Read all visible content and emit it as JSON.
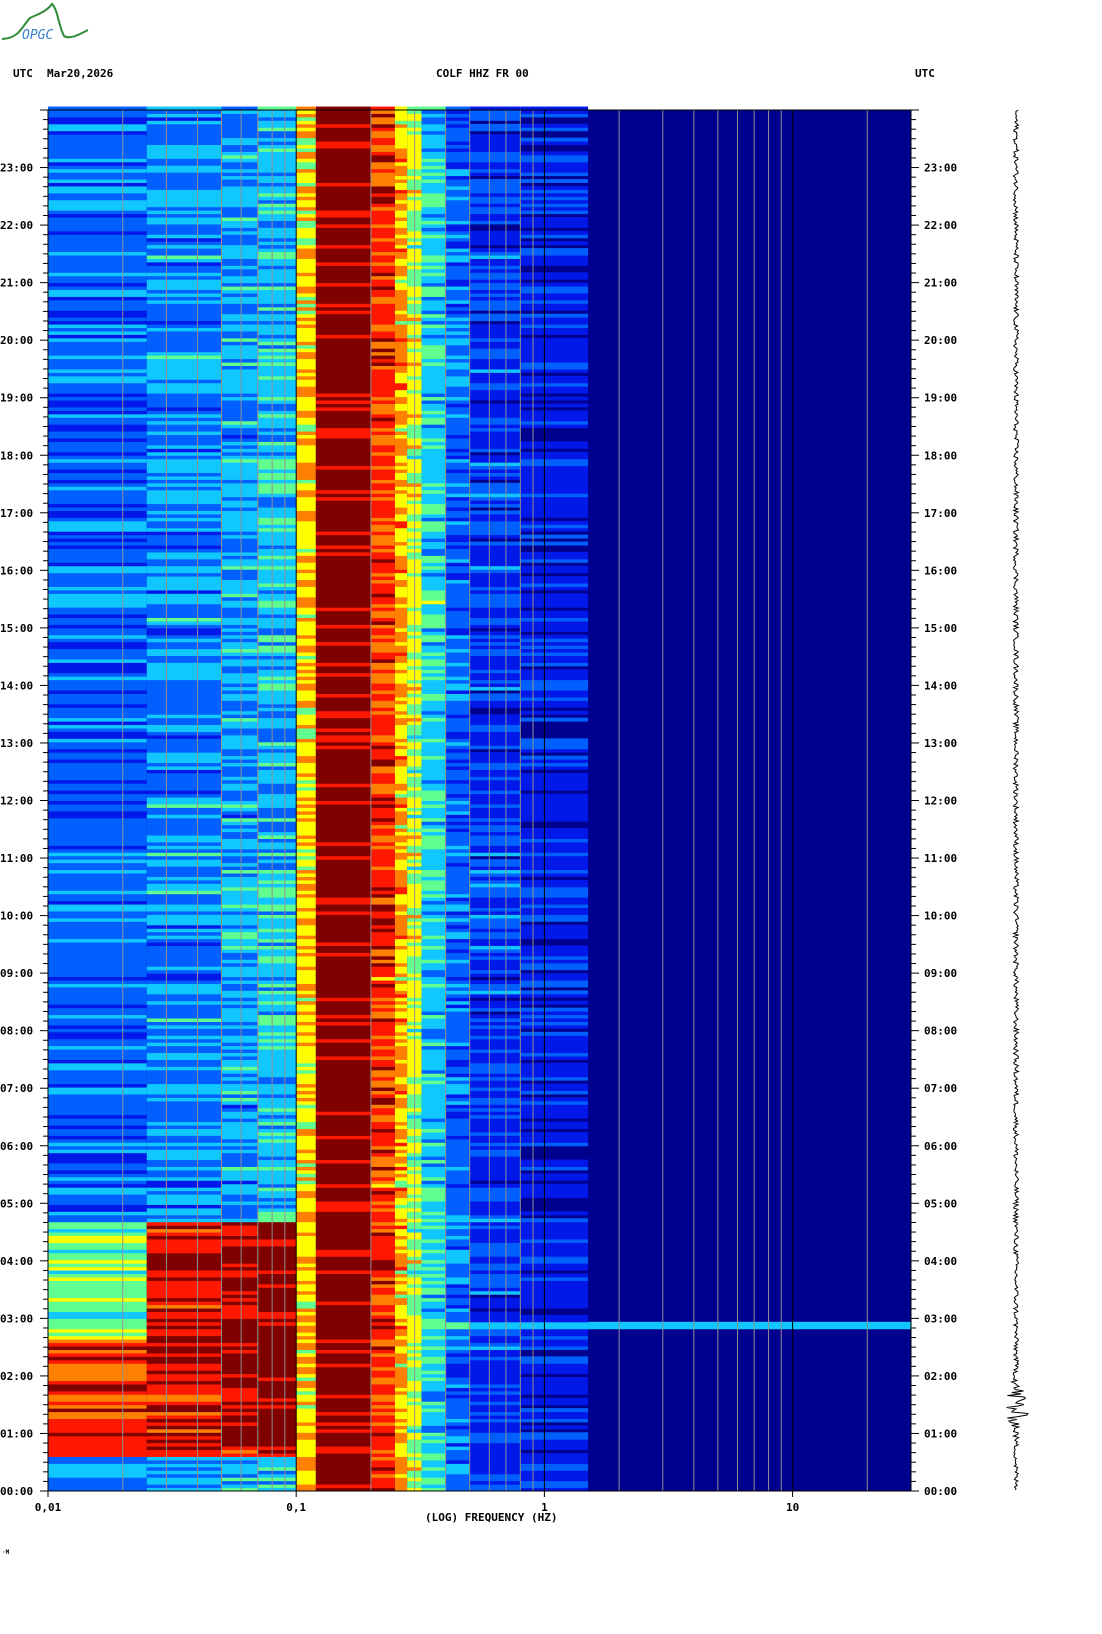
{
  "logo": {
    "text": "OPGC"
  },
  "header": {
    "left_tz": "UTC",
    "date": "Mar20,2026",
    "station": "COLF HHZ FR 00",
    "right_tz": "UTC"
  },
  "chart_data": {
    "type": "heatmap",
    "title": "COLF HHZ FR 00",
    "xlabel": "(LOG) FREQUENCY (HZ)",
    "xscale": "log",
    "xlim": [
      0.01,
      30
    ],
    "x_tick_labels": [
      {
        "v": 0.01,
        "label": "0,01"
      },
      {
        "v": 0.1,
        "label": "0,1"
      },
      {
        "v": 1,
        "label": "1"
      },
      {
        "v": 10,
        "label": "10"
      }
    ],
    "ylabel": "UTC",
    "ylim_hours": [
      0,
      24
    ],
    "y_tick_labels": [
      "00:00",
      "01:00",
      "02:00",
      "03:00",
      "04:00",
      "05:00",
      "06:00",
      "07:00",
      "08:00",
      "09:00",
      "10:00",
      "11:00",
      "12:00",
      "13:00",
      "14:00",
      "15:00",
      "16:00",
      "17:00",
      "18:00",
      "19:00",
      "20:00",
      "21:00",
      "22:00",
      "23:00"
    ],
    "colormap": [
      "#00008f",
      "#0018e8",
      "#0060ff",
      "#10c8ff",
      "#60ff90",
      "#ffff00",
      "#ff8000",
      "#ff1800",
      "#800000"
    ],
    "bands": [
      {
        "f0": 0.01,
        "f1": 0.025,
        "level": 2.0
      },
      {
        "f0": 0.025,
        "f1": 0.05,
        "level": 2.4
      },
      {
        "f0": 0.05,
        "f1": 0.07,
        "level": 2.7
      },
      {
        "f0": 0.07,
        "f1": 0.1,
        "level": 3.0
      },
      {
        "f0": 0.1,
        "f1": 0.12,
        "level": 5.2
      },
      {
        "f0": 0.12,
        "f1": 0.2,
        "level": 8.0
      },
      {
        "f0": 0.2,
        "f1": 0.25,
        "level": 6.8
      },
      {
        "f0": 0.25,
        "f1": 0.28,
        "level": 5.6
      },
      {
        "f0": 0.28,
        "f1": 0.32,
        "level": 4.6
      },
      {
        "f0": 0.32,
        "f1": 0.4,
        "level": 3.2
      },
      {
        "f0": 0.4,
        "f1": 0.5,
        "level": 2.1
      },
      {
        "f0": 0.5,
        "f1": 0.8,
        "level": 1.4
      },
      {
        "f0": 0.8,
        "f1": 1.5,
        "level": 1.0
      },
      {
        "f0": 1.5,
        "f1": 30,
        "level": 0.0
      }
    ],
    "events": [
      {
        "name": "low-frequency energy burst",
        "start_hour": 0.55,
        "end_hour": 4.65,
        "fmax": 0.1,
        "boost": 5
      },
      {
        "name": "earthquake",
        "hour": 2.85,
        "fmax": 3
      }
    ],
    "seismogram": {
      "quiet_amplitude": 1,
      "event_start_hour": 0.8,
      "event_end_hour": 2.2,
      "event_amplitude": 5
    }
  },
  "footer": {
    "mark": "·M"
  }
}
